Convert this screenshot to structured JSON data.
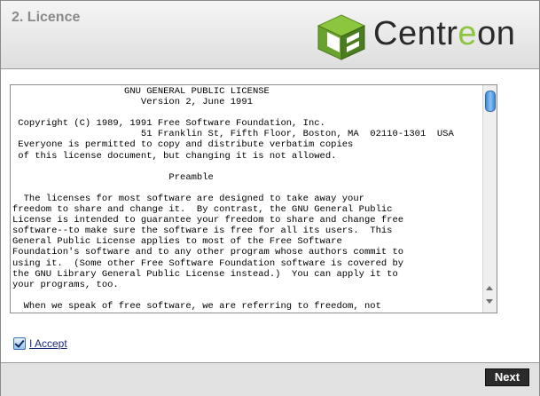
{
  "header": {
    "step_title": "2. Licence",
    "logo_text": "Centreon",
    "logo_text_prefix": "Centr",
    "logo_text_highlight": "e",
    "logo_text_suffix": "on"
  },
  "license": {
    "text": "                    GNU GENERAL PUBLIC LICENSE\n                       Version 2, June 1991\n\n Copyright (C) 1989, 1991 Free Software Foundation, Inc.\n                       51 Franklin St, Fifth Floor, Boston, MA  02110-1301  USA\n Everyone is permitted to copy and distribute verbatim copies\n of this license document, but changing it is not allowed.\n\n                            Preamble\n\n  The licenses for most software are designed to take away your\nfreedom to share and change it.  By contrast, the GNU General Public\nLicense is intended to guarantee your freedom to share and change free\nsoftware--to make sure the software is free for all its users.  This\nGeneral Public License applies to most of the Free Software\nFoundation's software and to any other program whose authors commit to\nusing it.  (Some other Free Software Foundation software is covered by\nthe GNU Library General Public License instead.)  You can apply it to\nyour programs, too.\n\n  When we speak of free software, we are referring to freedom, not\n  price.  Our General Public Licenses are designed to make sure that you"
  },
  "accept": {
    "label": "I Accept",
    "checked": true
  },
  "footer": {
    "next_label": "Next"
  },
  "colors": {
    "logo_green": "#8cc63f",
    "next_bg": "#2b2b2b",
    "thumb_blue": "#3d8ad8"
  }
}
